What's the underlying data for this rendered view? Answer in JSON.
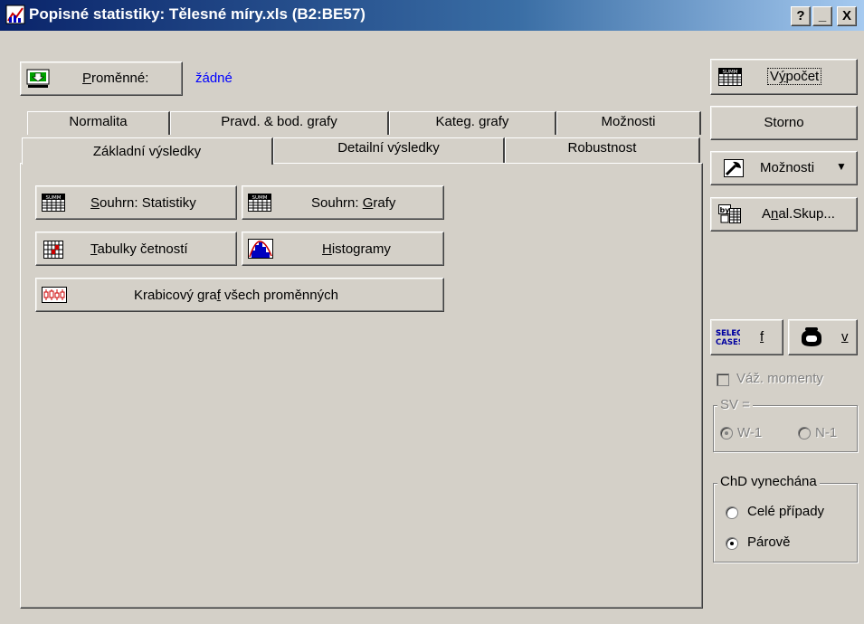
{
  "window": {
    "title": "Popisné statistiky: Tělesné míry.xls (B2:BE57)",
    "help": "?",
    "minimize": "_",
    "close": "X"
  },
  "variables": {
    "button_label": "Proměnné:",
    "value": "žádné"
  },
  "tabs_row1": [
    "Normalita",
    "Pravd. & bod. grafy",
    "Kateg. grafy",
    "Možnosti"
  ],
  "tabs_row2": [
    "Základní výsledky",
    "Detailní výsledky",
    "Robustnost"
  ],
  "panel": {
    "summary_stats": "Souhrn: Statistiky",
    "summary_graphs": "Souhrn: Grafy",
    "freq_tables": "Tabulky četností",
    "histograms": "Histogramy",
    "boxplot": "Krabicový graf všech proměnných"
  },
  "right": {
    "compute": "Výpočet",
    "cancel": "Storno",
    "options": "Možnosti",
    "by_group": "Anal.Skup...",
    "select_cases_icon_text": "SELECT CASES",
    "select_cases_key": "f",
    "weight_key": "v",
    "weighted_moments": "Váž. momenty",
    "df_group": "SV =",
    "df_w1": "W-1",
    "df_n1": "N-1",
    "md_group": "ChD vynechána",
    "md_casewise": "Celé případy",
    "md_pairwise": "Párově"
  }
}
